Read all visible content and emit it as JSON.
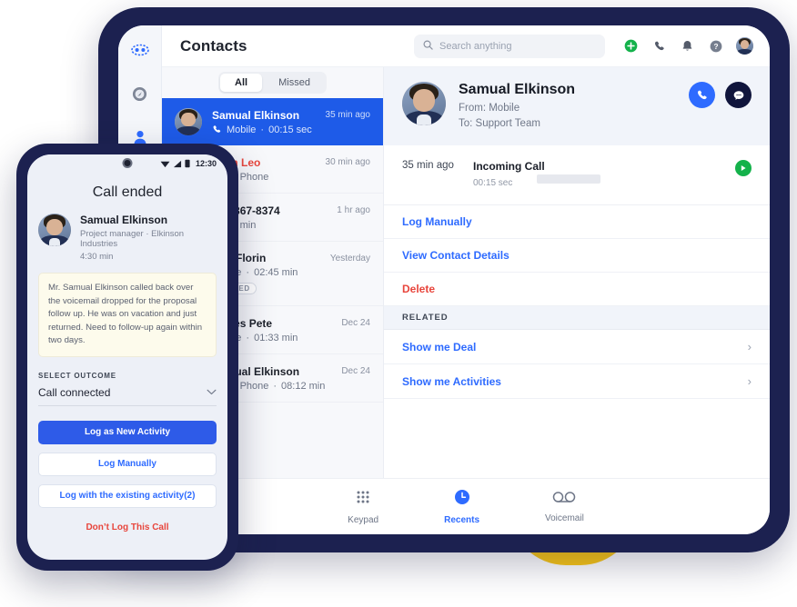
{
  "app": {
    "page_title": "Contacts",
    "search": {
      "placeholder": "Search anything",
      "value": ""
    },
    "topbar_icons": [
      "add-icon",
      "phone-icon",
      "bell-icon",
      "help-icon",
      "user-avatar"
    ],
    "sidebar": {
      "items": [
        {
          "name": "logo",
          "icon": "logo-icon"
        },
        {
          "name": "dashboard",
          "icon": "compass-icon"
        },
        {
          "name": "contacts",
          "icon": "person-icon",
          "active": true
        },
        {
          "name": "keypad",
          "icon": "keypad-icon"
        }
      ]
    }
  },
  "list_panel": {
    "tabs": [
      {
        "label": "All",
        "active": true
      },
      {
        "label": "Missed",
        "active": false
      }
    ],
    "rows": [
      {
        "name": "Samual Elkinson",
        "channel": "Mobile",
        "duration": "00:15 sec",
        "time": "35 min ago",
        "selected": true,
        "missed": false,
        "badge": ""
      },
      {
        "name": "Jhon Leo",
        "channel": "Other Phone",
        "duration": "",
        "time": "30 min ago",
        "selected": false,
        "missed": true,
        "badge": ""
      },
      {
        "name": "408-867-8374",
        "channel": "",
        "duration": "02:10 min",
        "time": "1 hr ago",
        "selected": false,
        "missed": false,
        "badge": ""
      },
      {
        "name": "Ana Florin",
        "channel": "Mobile",
        "duration": "02:45 min",
        "time": "Yesterday",
        "selected": false,
        "missed": false,
        "badge": "MISSED"
      },
      {
        "name": "James Pete",
        "channel": "Mobile",
        "duration": "01:33 min",
        "time": "Dec 24",
        "selected": false,
        "missed": false,
        "badge": ""
      },
      {
        "name": "Samual Elkinson",
        "channel": "Other Phone",
        "duration": "08:12 min",
        "time": "Dec 24",
        "selected": false,
        "missed": false,
        "badge": ""
      }
    ]
  },
  "detail": {
    "name": "Samual Elkinson",
    "from": "From: Mobile",
    "to": "To: Support Team",
    "call_button": "call-icon",
    "message_button": "message-icon",
    "entry": {
      "time": "35 min ago",
      "title": "Incoming Call",
      "duration": "00:15 sec",
      "play": "play-icon"
    },
    "actions": [
      {
        "label": "Log Manually",
        "kind": "link"
      },
      {
        "label": "View Contact Details",
        "kind": "link"
      },
      {
        "label": "Delete",
        "kind": "danger"
      }
    ],
    "related_header": "RELATED",
    "related": [
      {
        "label": "Show me Deal",
        "chevron": "›"
      },
      {
        "label": "Show me Activities",
        "chevron": "›"
      }
    ]
  },
  "bottom_nav": [
    {
      "label": "Keypad",
      "icon": "keypad-icon",
      "active": false
    },
    {
      "label": "Recents",
      "icon": "clock-icon",
      "active": true
    },
    {
      "label": "Voicemail",
      "icon": "voicemail-icon",
      "active": false
    }
  ],
  "phone": {
    "status": {
      "time": "12:30",
      "icons": [
        "wifi-icon",
        "signal-icon",
        "battery-icon"
      ]
    },
    "title": "Call ended",
    "contact": {
      "name": "Samual Elkinson",
      "role": "Project manager · Elkinson Industries",
      "duration": "4:30 min"
    },
    "note": "Mr. Samual Elkinson called back over the voicemail dropped for the proposal follow up. He was on vacation and just returned. Need to follow-up again within two days.",
    "outcome_label": "SELECT OUTCOME",
    "outcome_value": "Call connected",
    "buttons": [
      {
        "label": "Log as New Activity",
        "style": "primary"
      },
      {
        "label": "Log Manually",
        "style": "secondary"
      },
      {
        "label": "Log with the existing activity(2)",
        "style": "secondary"
      }
    ],
    "dont_log": "Don’t Log This Call"
  },
  "colors": {
    "accent_blue": "#2E6BFF",
    "selected_blue": "#1E5BE8",
    "danger_red": "#E8453C",
    "green": "#14B24B",
    "bezel_navy": "#1C2150",
    "yellow": "#FBC816"
  }
}
